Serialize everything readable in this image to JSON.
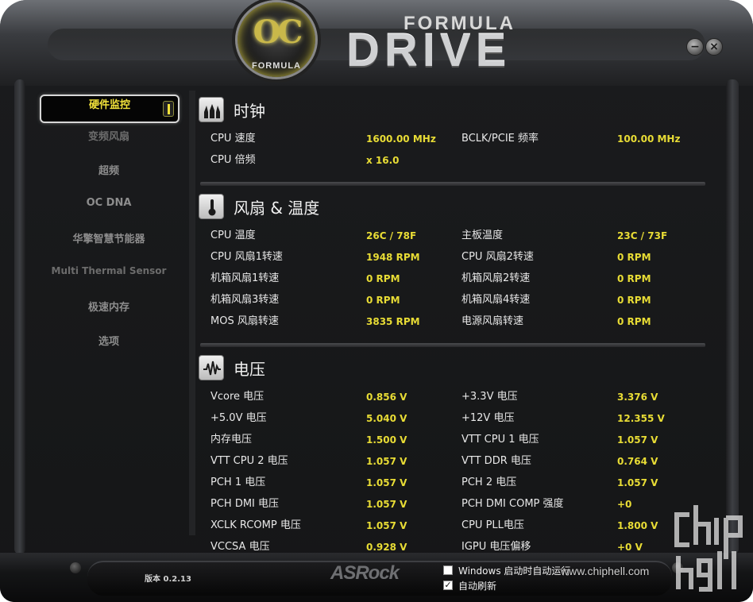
{
  "window": {
    "logo_oc": "OC",
    "logo_formula_small": "FORMULA",
    "logo_formula": "FORMULA",
    "logo_drive": "DRIVE",
    "minimize_glyph": "−",
    "close_glyph": "×"
  },
  "sidebar": {
    "items": [
      {
        "label": "硬件监控"
      },
      {
        "label": "变频风扇"
      },
      {
        "label": "超频"
      },
      {
        "label": "OC DNA"
      },
      {
        "label": "华擎智慧节能器"
      },
      {
        "label": "Multi Thermal Sensor"
      },
      {
        "label": "极速内存"
      },
      {
        "label": "选项"
      }
    ]
  },
  "sections": {
    "clock": {
      "title": "时钟",
      "rows": [
        {
          "l1": "CPU 速度",
          "v1": "1600.00 MHz",
          "l2": "BCLK/PCIE 频率",
          "v2": "100.00 MHz"
        },
        {
          "l1": "CPU 倍频",
          "v1": "x 16.0"
        }
      ]
    },
    "fan_temp": {
      "title": "风扇 & 温度",
      "rows": [
        {
          "l1": "CPU 温度",
          "v1": "26C / 78F",
          "l2": "主板温度",
          "v2": "23C / 73F"
        },
        {
          "l1": "CPU 风扇1转速",
          "v1": "1948 RPM",
          "l2": "CPU 风扇2转速",
          "v2": "0 RPM"
        },
        {
          "l1": "机箱风扇1转速",
          "v1": "0 RPM",
          "l2": "机箱风扇2转速",
          "v2": "0 RPM"
        },
        {
          "l1": "机箱风扇3转速",
          "v1": "0 RPM",
          "l2": "机箱风扇4转速",
          "v2": "0 RPM"
        },
        {
          "l1": "MOS 风扇转速",
          "v1": "3835 RPM",
          "l2": "电源风扇转速",
          "v2": "0 RPM"
        }
      ]
    },
    "voltage": {
      "title": "电压",
      "rows": [
        {
          "l1": "Vcore 电压",
          "v1": "0.856 V",
          "l2": "+3.3V 电压",
          "v2": "3.376 V"
        },
        {
          "l1": "+5.0V 电压",
          "v1": "5.040 V",
          "l2": "+12V 电压",
          "v2": "12.355 V"
        },
        {
          "l1": "内存电压",
          "v1": "1.500 V",
          "l2": "VTT CPU 1 电压",
          "v2": "1.057 V"
        },
        {
          "l1": "VTT CPU 2 电压",
          "v1": "1.057 V",
          "l2": "VTT DDR 电压",
          "v2": "0.764 V"
        },
        {
          "l1": "PCH 1 电压",
          "v1": "1.057 V",
          "l2": "PCH 2 电压",
          "v2": "1.057 V"
        },
        {
          "l1": "PCH DMI 电压",
          "v1": "1.057 V",
          "l2": "PCH DMI COMP 强度",
          "v2": "+0"
        },
        {
          "l1": "XCLK RCOMP 电压",
          "v1": "1.057 V",
          "l2": "CPU PLL电压",
          "v2": "1.800 V"
        },
        {
          "l1": "VCCSA 电压",
          "v1": "0.928 V",
          "l2": "IGPU 电压偏移",
          "v2": "+0 V"
        }
      ]
    }
  },
  "footer": {
    "version": "版本 0.2.13",
    "brand": "ASRock",
    "startup_checkbox": {
      "label": "Windows 启动时自动运行",
      "checked": false
    },
    "autorefresh_checkbox": {
      "label": "自动刷新",
      "checked": true,
      "mark": "✓"
    }
  },
  "watermark": {
    "url": "www.chiphell.com",
    "logo_text": "chip hell"
  },
  "colors": {
    "accent_yellow": "#e8dc35",
    "label_white": "#e8e8e8",
    "window_dark": "#151617"
  },
  "icons": {
    "clock": "clock-bars-icon",
    "fan_temp": "thermometer-icon",
    "voltage": "waveform-icon"
  }
}
